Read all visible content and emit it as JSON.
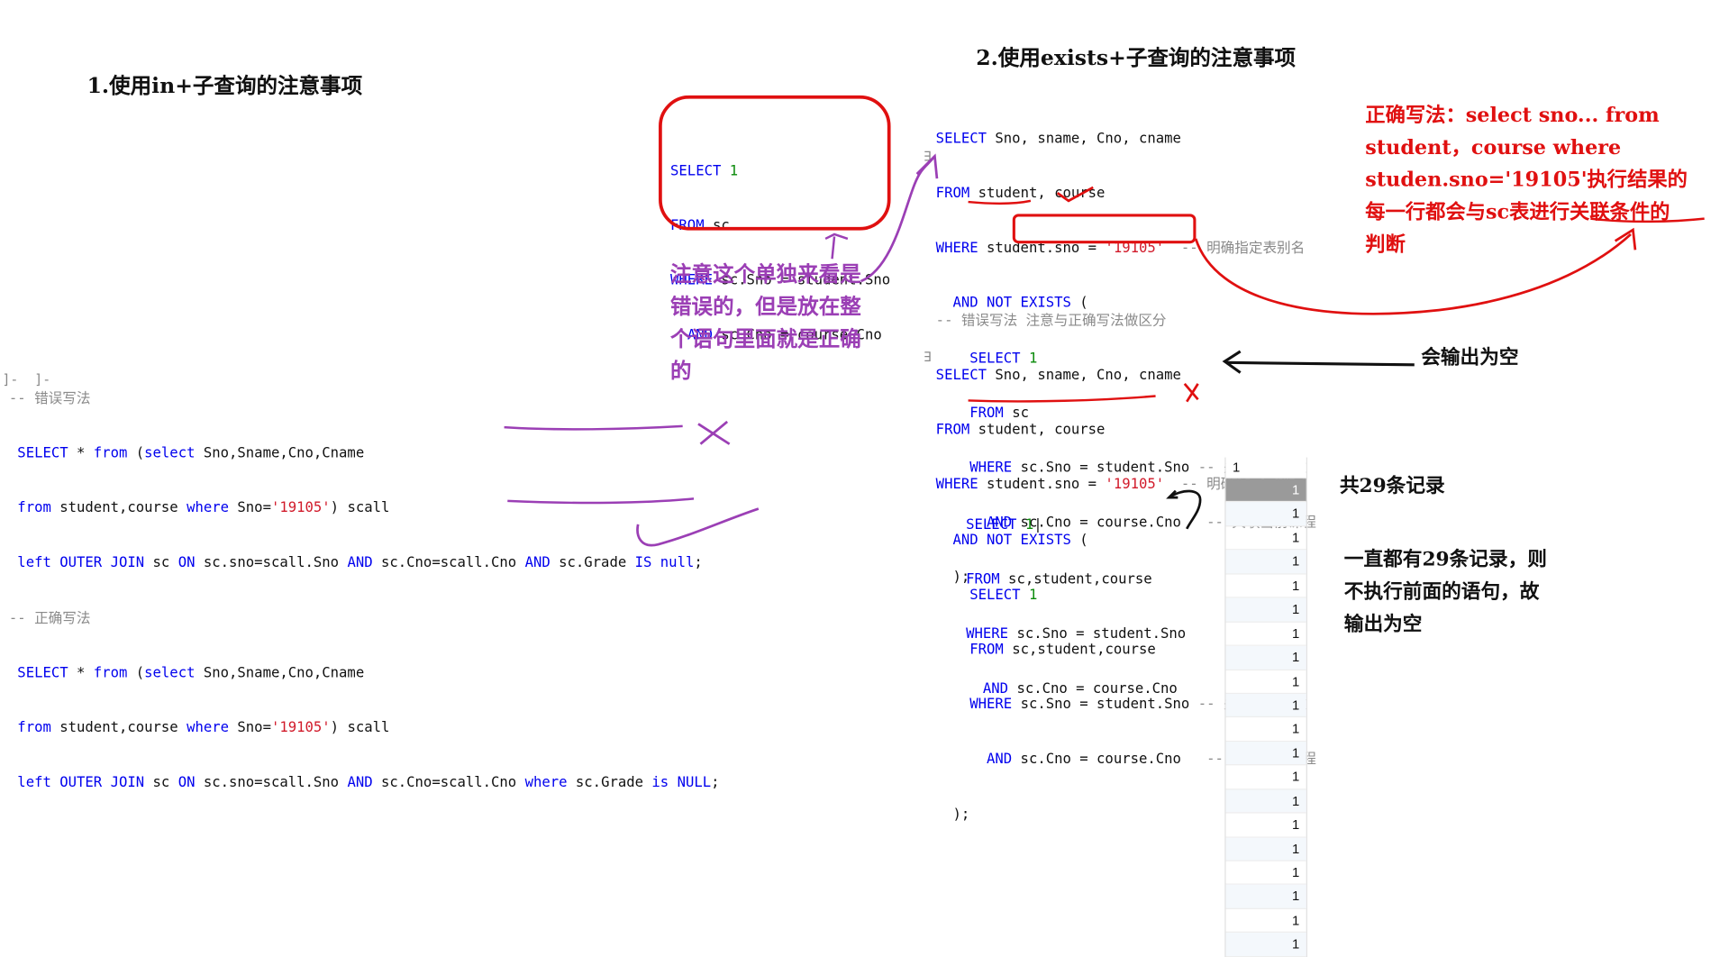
{
  "heading_in": "1.使用in+子查询的注意事项",
  "heading_exists": "2.使用exists+子查询的注意事项",
  "left_code": {
    "c_wrong": "-- 错误写法",
    "c_right": "-- 正确写法",
    "kw_select": "SELECT",
    "star": " * ",
    "kw_from": "from",
    "paren_open": " (",
    "kw_select_lower": "select",
    "cols": " Sno,Sname,Cno,Cname",
    "tables": " student,course ",
    "kw_where": "where",
    "sno_eq": " Sno=",
    "str_19105": "'19105'",
    "scall": ") scall",
    "kw_left": "left",
    "kw_outer_join": " OUTER JOIN",
    "sc": " sc ",
    "kw_on": "ON",
    "join_cond": " sc.sno=scall.Sno ",
    "kw_and": "AND",
    "join_cond2": " sc.Cno=scall.Cno ",
    "grade": " sc.Grade ",
    "kw_is": "IS",
    "kw_is_lower": "is",
    "kw_null": "null",
    "kw_null_upper": "NULL",
    "semi": ";"
  },
  "boxed_code": {
    "kw_select": "SELECT",
    "one": "1",
    "kw_from": "FROM",
    "sc": " sc",
    "kw_where": "WHERE",
    "cond1": " sc.Sno = student.Sno",
    "kw_and": "AND",
    "cond2": " sc.Cno = course.Cno"
  },
  "right_code": {
    "kw_select": "SELECT",
    "cols": " Sno, sname, Cno, cname",
    "kw_from": "FROM",
    "tables": " student, course",
    "kw_where": "WHERE",
    "sno_eq": " student.sno = ",
    "str_19105": "'19105'",
    "c_alias": "  -- 明确指定表别名",
    "kw_and_not_exists": "AND NOT EXISTS",
    "paren_open": " (",
    "one": "1",
    "sc": " sc",
    "sc_multi": " sc,student,course",
    "cond1": " sc.Sno = student.Sno",
    "cond1_tight": "sc.Sno = student.Sno",
    "kw_and": "AND",
    "cond2": " sc.Cno = course.Cno",
    "cond2_tight": "sc.Cno = course.Cno",
    "c_student": "-- 关联当前学生",
    "c_course": "-- 关联当前课程",
    "close": ");",
    "c_wrong": "-- 错误写法 注意与正确写法做区分",
    "cursor": "|"
  },
  "notes": {
    "purple": "注意这个单独来看是\n错误的，但是放在整\n个语句里面就是正确\n的",
    "red": "正确写法：select sno... from\nstudent，course where\nstuden.sno='19105'执行结果的\n每一行都会与sc表进行关联条件的\n判断",
    "output_empty": "会输出为空",
    "count": "共29条记录",
    "explain": "一直都有29条记录，则\n不执行前面的语句，故\n输出为空"
  },
  "result_grid": {
    "header": "1",
    "rows": [
      "1",
      "1",
      "1",
      "1",
      "1",
      "1",
      "1",
      "1",
      "1",
      "1",
      "1",
      "1",
      "1",
      "1",
      "1",
      "1",
      "1",
      "1",
      "1",
      "1"
    ]
  },
  "colors": {
    "keyword": "#0000ee",
    "string": "#d11a2a",
    "number": "#0a8a0a",
    "comment": "#8a8a8a",
    "purple_ink": "#9b3fb5",
    "red_ink": "#e01010"
  }
}
